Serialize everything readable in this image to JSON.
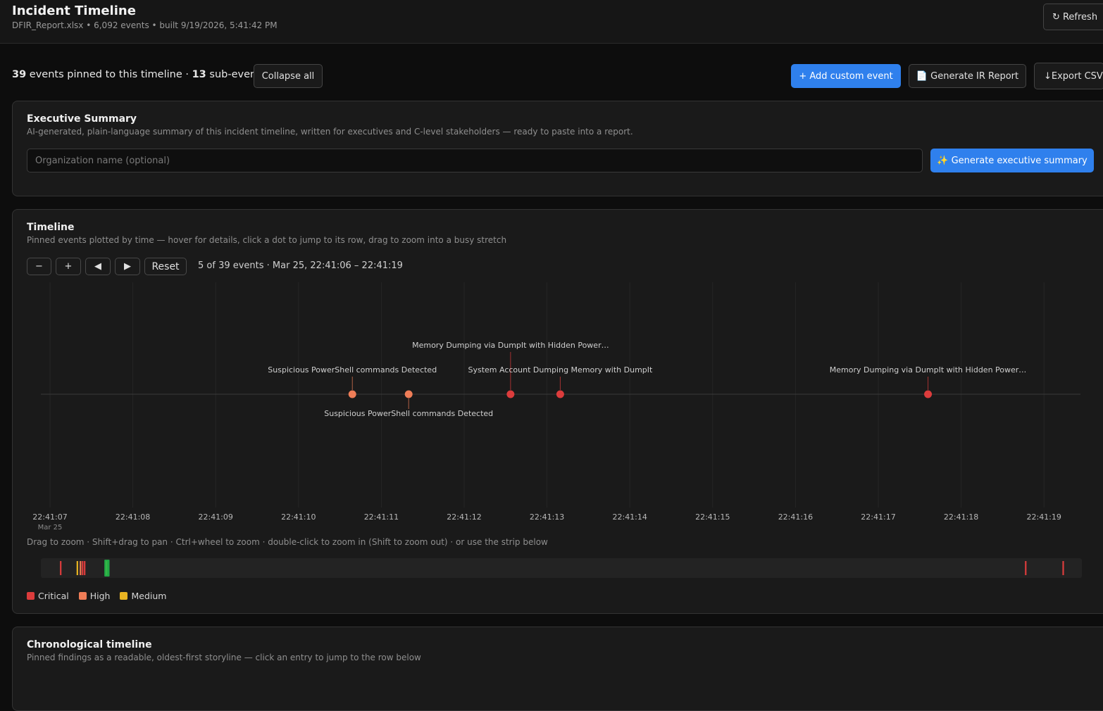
{
  "header": {
    "title": "Incident Timeline",
    "subtitle": "DFIR_Report.xlsx • 6,092 events • built 9/19/2026, 5:41:42 PM",
    "refresh_label": "↻ Refresh"
  },
  "toolbar": {
    "pinned_count": "39",
    "pinned_text": " events pinned to this timeline · ",
    "sub_count": "13",
    "sub_text": " sub-events",
    "collapse_label": "Collapse all",
    "add_label": "+ Add custom event",
    "report_label": "📄 Generate IR Report",
    "export_label": "↓Export CSV"
  },
  "exec_summary": {
    "title": "Executive Summary",
    "description": "AI-generated, plain-language summary of this incident timeline, written for executives and C-level stakeholders — ready to paste into a report.",
    "org_placeholder": "Organization name (optional)",
    "generate_label": "✨ Generate executive summary"
  },
  "timeline": {
    "title": "Timeline",
    "description": "Pinned events plotted by time — hover for details, click a dot to jump to its row, drag to zoom into a busy stretch",
    "zoom_out_label": "−",
    "zoom_in_label": "+",
    "prev_label": "◀",
    "next_label": "▶",
    "reset_label": "Reset",
    "range_text": "5 of 39 events · Mar 25, 22:41:06 – 22:41:19",
    "hint": "Drag to zoom · Shift+drag to pan · Ctrl+wheel to zoom · double-click to zoom in (Shift to zoom out) · or use the strip below",
    "date_label": "Mar 25",
    "tick_labels": [
      "22:41:07",
      "22:41:08",
      "22:41:09",
      "22:41:10",
      "22:41:11",
      "22:41:12",
      "22:41:13",
      "22:41:14",
      "22:41:15",
      "22:41:16",
      "22:41:17",
      "22:41:18",
      "22:41:19"
    ],
    "events": [
      {
        "label": "Suspicious PowerShell commands Detected",
        "time_s": 10.65,
        "severity": "High",
        "label_pos": "above-near"
      },
      {
        "label": "Suspicious PowerShell commands Detected",
        "time_s": 11.33,
        "severity": "High",
        "label_pos": "below"
      },
      {
        "label": "Memory Dumping via DumpIt with Hidden Power…",
        "time_s": 12.56,
        "severity": "Critical",
        "label_pos": "above-far"
      },
      {
        "label": "System Account Dumping Memory with DumpIt",
        "time_s": 13.16,
        "severity": "Critical",
        "label_pos": "above-near"
      },
      {
        "label": "Memory Dumping via DumpIt with Hidden Power…",
        "time_s": 17.6,
        "severity": "Critical",
        "label_pos": "above-near"
      }
    ],
    "overview_marks": [
      {
        "pos": 0.019,
        "severity": "Critical"
      },
      {
        "pos": 0.035,
        "severity": "Medium"
      },
      {
        "pos": 0.038,
        "severity": "High"
      },
      {
        "pos": 0.04,
        "severity": "Critical"
      },
      {
        "pos": 0.042,
        "severity": "Critical"
      },
      {
        "pos": 0.063,
        "severity": "Medium"
      },
      {
        "pos": 0.946,
        "severity": "Critical"
      },
      {
        "pos": 0.982,
        "severity": "Critical"
      }
    ],
    "overview_window": {
      "start": 0.061,
      "end": 0.066
    },
    "legend": [
      {
        "label": "Critical",
        "color": "#dc3c3c"
      },
      {
        "label": "High",
        "color": "#ef7d57"
      },
      {
        "label": "Medium",
        "color": "#e9b422"
      }
    ]
  },
  "chronological": {
    "title": "Chronological timeline",
    "description": "Pinned findings as a readable, oldest-first storyline — click an entry to jump to the row below"
  },
  "colors": {
    "Critical": "#dc3c3c",
    "High": "#ef7d57",
    "Medium": "#e9b422",
    "window": "#22b84a",
    "accent": "#2f80ed"
  }
}
